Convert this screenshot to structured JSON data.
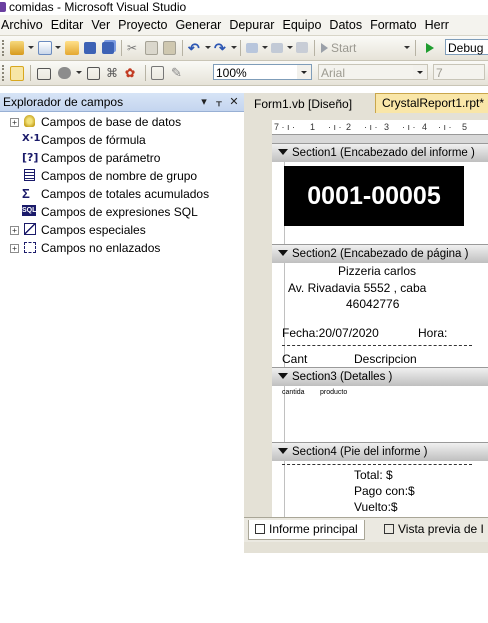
{
  "window": {
    "title": "comidas - Microsoft Visual Studio"
  },
  "menu": [
    "Archivo",
    "Editar",
    "Ver",
    "Proyecto",
    "Generar",
    "Depurar",
    "Equipo",
    "Datos",
    "Formato",
    "Herr"
  ],
  "toolbar1": {
    "start_label": "Start",
    "config_value": "Debug"
  },
  "toolbar2": {
    "zoom_value": "100%",
    "font_value": "Arial",
    "size_value": "7"
  },
  "field_explorer": {
    "title": "Explorador de campos",
    "items": [
      {
        "label": "Campos de base de datos",
        "icon": "database-icon",
        "expandable": true
      },
      {
        "label": "Campos de fórmula",
        "icon": "formula-icon",
        "expandable": false
      },
      {
        "label": "Campos de parámetro",
        "icon": "parameter-icon",
        "expandable": false
      },
      {
        "label": "Campos de nombre de grupo",
        "icon": "group-name-icon",
        "expandable": false
      },
      {
        "label": "Campos de totales acumulados",
        "icon": "running-total-icon",
        "expandable": false
      },
      {
        "label": "Campos de expresiones SQL",
        "icon": "sql-icon",
        "expandable": false
      },
      {
        "label": "Campos especiales",
        "icon": "special-fields-icon",
        "expandable": true
      },
      {
        "label": "Campos no enlazados",
        "icon": "unbound-fields-icon",
        "expandable": true
      }
    ]
  },
  "editor_tabs": [
    {
      "label": "Form1.vb [Diseño]",
      "active": false
    },
    {
      "label": "CrystalReport1.rpt*",
      "active": true
    }
  ],
  "report": {
    "sections": [
      {
        "header": "Section1 (Encabezado del informe )"
      },
      {
        "header": "Section2 (Encabezado de página )"
      },
      {
        "header": "Section3 (Detalles )"
      },
      {
        "header": "Section4 (Pie del informe )"
      }
    ],
    "title_box": "0001-00005",
    "shop_name": "Pizzeria carlos",
    "address": "Av. Rivadavia 5552 , caba",
    "phone": "46042776",
    "date_label": "Fecha:20/07/2020",
    "time_label": "Hora:",
    "col_qty": "Cant",
    "col_desc": "Descripcion",
    "field_qty": "cantida",
    "field_product": "producto",
    "total_label": "Total: $",
    "paid_label": "Pago con:$",
    "change_label": "Vuelto:$",
    "ruler_marks": [
      "1",
      "2",
      "3",
      "4",
      "5"
    ]
  },
  "bottom_tabs": [
    "Informe principal",
    "Vista previa de I"
  ],
  "colors": {
    "title_box_bg": "#000000",
    "title_box_fg": "#ffffff",
    "active_tab": "#f9e6a8"
  }
}
